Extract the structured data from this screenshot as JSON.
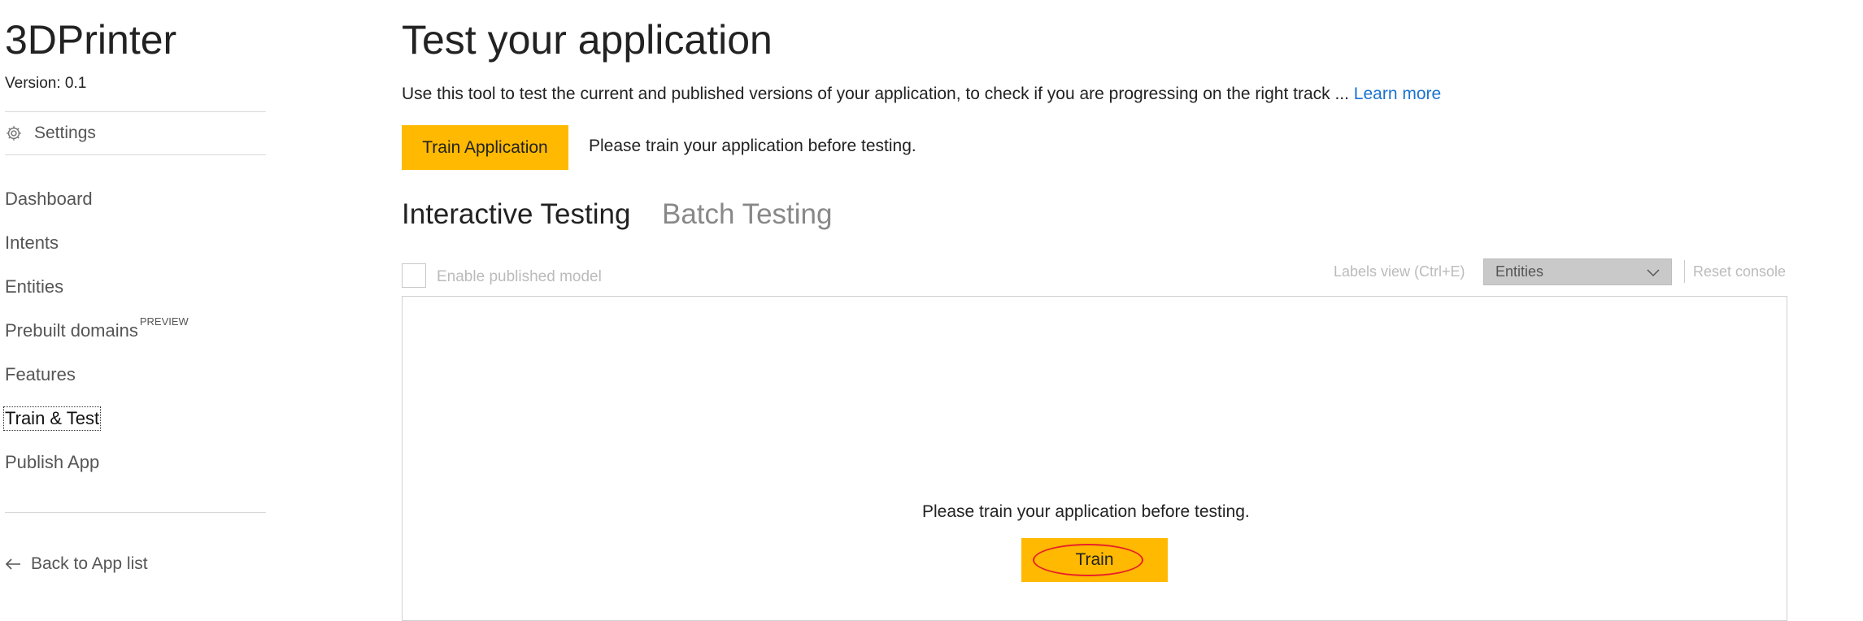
{
  "sidebar": {
    "app_title": "3DPrinter",
    "version": "Version:  0.1",
    "settings_label": "Settings",
    "items": [
      {
        "label": "Dashboard"
      },
      {
        "label": "Intents"
      },
      {
        "label": "Entities"
      },
      {
        "label": "Prebuilt domains",
        "badge": "PREVIEW"
      },
      {
        "label": "Features"
      },
      {
        "label": "Train & Test",
        "active": true
      },
      {
        "label": "Publish App"
      }
    ],
    "back_label": "Back to App list"
  },
  "main": {
    "title": "Test your application",
    "description": "Use this tool to test the current and published versions of your application, to check if you are progressing on the right track ... ",
    "learn_more": "Learn more",
    "train_application_label": "Train Application",
    "train_message": "Please train your application before testing.",
    "tabs": [
      {
        "label": "Interactive Testing",
        "active": true
      },
      {
        "label": "Batch Testing",
        "active": false
      }
    ],
    "enable_published_label": "Enable published model",
    "labels_view_label": "Labels view (Ctrl+E)",
    "labels_view_selected": "Entities",
    "reset_console_label": "Reset console",
    "console_message": "Please train your application before testing.",
    "train_label": "Train"
  },
  "colors": {
    "accent": "#ffb900",
    "link": "#1a73d0",
    "annotation": "#e8202a"
  }
}
